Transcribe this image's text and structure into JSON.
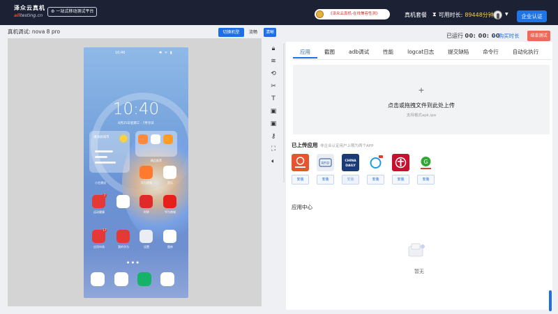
{
  "header": {
    "logo_cn": "泽众云真机",
    "logo_en_prefix": "all",
    "logo_en_suffix": "testing.cn",
    "tagline": "一站式移动测试平台",
    "banner_text": "《泽众云真机-在线兼容性测》",
    "plan_link": "真机套餐",
    "timer_label": "可用时长:",
    "timer_value": "89448分钟",
    "enterprise_button": "企业认证"
  },
  "device": {
    "title": "真机调试: nova 8 pro",
    "switch_button": "切换机型",
    "smooth_button": "流畅",
    "hd_button": "清晰"
  },
  "phone": {
    "status_time": "10:40",
    "status_icons": "✱ ᯤ ▮",
    "clock": "10:40",
    "date": "8月25日星期三 · 7月廿日",
    "weather_text": "请添加城市",
    "folder_label": "精品推荐",
    "apps": [
      {
        "label": "华为视频"
      },
      {
        "label": "小艺建议"
      },
      {
        "label": "音乐"
      },
      {
        "label": "运动健康"
      },
      {
        "label": "时钟"
      },
      {
        "label": "华为商城"
      },
      {
        "label": "应用市场"
      },
      {
        "label": "我的华为"
      },
      {
        "label": "设置"
      },
      {
        "label": "图库"
      }
    ],
    "badges": [
      "7",
      "17"
    ]
  },
  "run": {
    "label": "已运行",
    "time": "00: 00: 00",
    "buy_link": "+ 购买时长",
    "end_button": "结束测试"
  },
  "tabs": [
    "应用",
    "截图",
    "adb调试",
    "性能",
    "logcat日志",
    "提交缺陷",
    "命令行",
    "自动化执行"
  ],
  "upload": {
    "plus": "+",
    "title": "点击或拖拽文件到此处上传",
    "hint": "支持格式apk,ipa"
  },
  "uploaded": {
    "title": "已上传应用",
    "hint": "非企业认证用户上限为两个APP",
    "install_label": "安装",
    "apps": [
      {
        "color": "#e6552f",
        "text": "TESTING"
      },
      {
        "color": "#e9eef4",
        "text": "RFID"
      },
      {
        "color": "#1a3b75",
        "text": "CHINA DAILY"
      },
      {
        "color": "#ffffff",
        "text": ""
      },
      {
        "color": "#c8102e",
        "text": ""
      },
      {
        "color": "#ffffff",
        "text": ""
      }
    ]
  },
  "app_center": {
    "title": "应用中心",
    "empty_text": "暂无"
  },
  "colors": {
    "topbar": "#1c2233",
    "accent": "#1f6ee5",
    "end_button": "#ef6a5a",
    "timer": "#ffd04a"
  }
}
